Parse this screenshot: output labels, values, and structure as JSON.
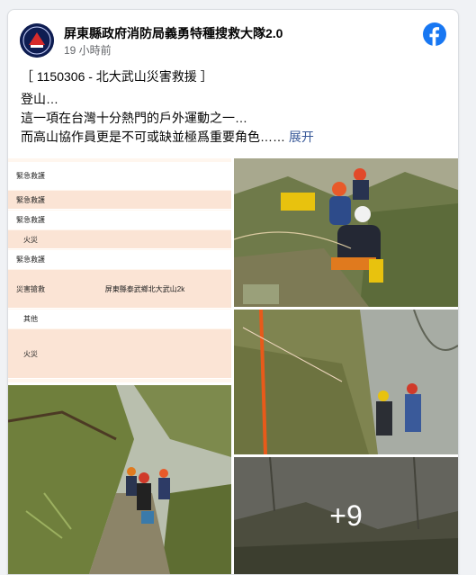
{
  "post": {
    "page_name": "屏東縣政府消防局義勇特種搜救大隊2.0",
    "timestamp": "19 小時前",
    "lines": [
      "［ 1150306 - 北大武山災害救援 ］",
      "登山…",
      "這一項在台灣十分熱門的戶外運動之一…",
      "而高山協作員更是不可或缺並極爲重要角色……"
    ],
    "see_more": "展开"
  },
  "doc_table": {
    "rows": [
      {
        "label": "緊急救護",
        "value": ""
      },
      {
        "label": "緊急救護",
        "value": ""
      },
      {
        "label": "緊急救護",
        "value": ""
      },
      {
        "label": "火災",
        "value": ""
      },
      {
        "label": "緊急救護",
        "value": ""
      },
      {
        "label": "災害搶救",
        "value": "屏東縣泰武鄉北大武山2k"
      },
      {
        "label": "其他",
        "value": ""
      },
      {
        "label": "火災",
        "value": ""
      }
    ]
  },
  "more_photos": "+9",
  "colors": {
    "brand": "#1877f2",
    "link": "#385898",
    "doc_bg": "#fff6ee"
  },
  "icons": {
    "facebook": "facebook-logo-icon",
    "avatar": "rescue-team-avatar"
  }
}
